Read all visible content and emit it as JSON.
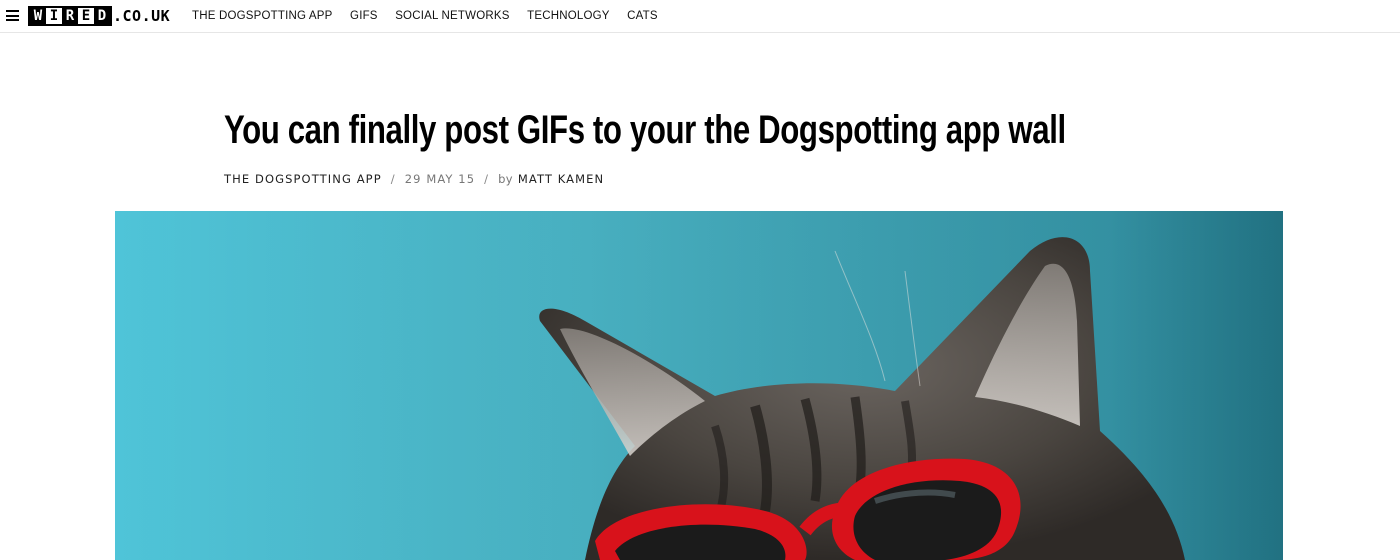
{
  "header": {
    "logo": {
      "letters": [
        "W",
        "I",
        "R",
        "E",
        "D"
      ],
      "suffix": ".CO.UK"
    },
    "nav": [
      {
        "label": "THE DOGSPOTTING APP"
      },
      {
        "label": "GIFS"
      },
      {
        "label": "SOCIAL NETWORKS"
      },
      {
        "label": "TECHNOLOGY"
      },
      {
        "label": "CATS"
      }
    ]
  },
  "article": {
    "title": "You can finally post GIFs to your the Dogspotting app wall",
    "byline": {
      "section": "THE DOGSPOTTING APP",
      "separator": "/",
      "date": "29 MAY 15",
      "by": "by",
      "author": "MATT KAMEN"
    },
    "hero_image": {
      "subject": "tabby cat wearing red sunglasses on turquoise background"
    }
  },
  "colors": {
    "hero_background": "#52c7da",
    "sunglasses": "#d8121b",
    "text": "#000000"
  },
  "icons": {
    "menu": "hamburger-menu-icon"
  }
}
